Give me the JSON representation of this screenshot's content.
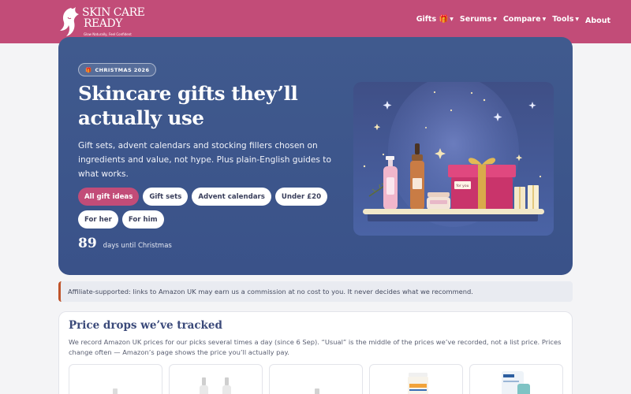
{
  "brand": {
    "line1": "SKIN CARE",
    "line2": "READY",
    "tagline": "Glow Naturally, Feel Confident"
  },
  "nav": {
    "gifts": "Gifts 🎁",
    "serums": "Serums",
    "compare": "Compare",
    "tools": "Tools",
    "about": "About"
  },
  "hero": {
    "badge_icon": "gift-icon",
    "badge": "CHRISTMAS 2026",
    "title": "Skincare gifts they’ll actually use",
    "subtitle": "Gift sets, advent calendars and stocking fillers chosen on ingredients and value, not hype. Plus plain-English guides to what works.",
    "pills": [
      {
        "label": "All gift ideas",
        "active": true
      },
      {
        "label": "Gift sets",
        "active": false
      },
      {
        "label": "Advent calendars",
        "active": false
      },
      {
        "label": "Under £20",
        "active": false
      },
      {
        "label": "For her",
        "active": false
      },
      {
        "label": "For him",
        "active": false
      }
    ],
    "days_count": "89",
    "days_label": "days until Christmas",
    "gift_tag": "for you"
  },
  "notice": {
    "text": "Affiliate-supported: links to Amazon UK may earn us a commission at no cost to you. It never decides what we recommend."
  },
  "price_drops": {
    "title": "Price drops we’ve tracked",
    "description": "We record Amazon UK prices for our picks several times a day (since 6 Sep). “Usual” is the middle of the prices we’ve recorded, not a list price. Prices change often — Amazon’s page shows the price you’ll actually pay."
  },
  "colors": {
    "brand_pink": "#c24c78",
    "hero_blue": "#3a5289",
    "notice_accent": "#c0542b",
    "heading_blue": "#3b4a7a"
  }
}
